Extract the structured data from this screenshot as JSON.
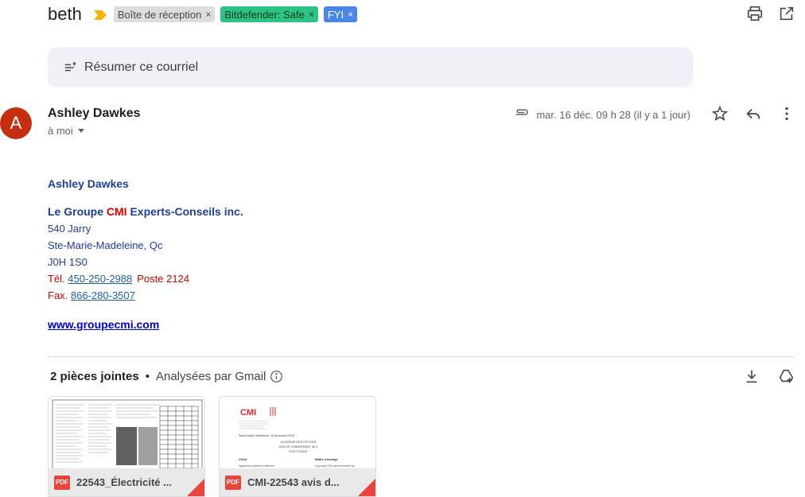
{
  "subject": "beth",
  "labels": [
    {
      "text": "Boîte de réception",
      "color": "#dddddd"
    },
    {
      "text": "Bitdefender: Safe",
      "color": "#2cc383"
    },
    {
      "text": "FYI",
      "color": "#4a86e8"
    }
  ],
  "icons": {
    "print": "print-icon",
    "popout": "open-in-new-window-icon",
    "summarize": "summarize-sparkle-icon",
    "attachment": "paperclip-icon",
    "star": "star-icon",
    "reply": "reply-icon",
    "more": "more-vertical-icon",
    "info": "info-icon",
    "download_all": "download-icon",
    "drive": "add-to-drive-icon"
  },
  "summarize": {
    "label": "Résumer ce courriel"
  },
  "message": {
    "avatar_letter": "A",
    "avatar_color": "#c4300f",
    "sender": "Ashley Dawkes",
    "recipient": "à moi",
    "date": "mar. 16 déc. 09 h 28 (il y a 1 jour)"
  },
  "signature": {
    "name": "Ashley Dawkes",
    "company_prefix": "Le Groupe ",
    "company_highlight": "CMI",
    "company_suffix": " Experts-Conseils inc.",
    "address_1": "540 Jarry",
    "address_2": "Ste-Marie-Madeleine, Qc",
    "address_3": "J0H 1S0",
    "tel_label": "Tél. ",
    "tel_number": "450-250-2988",
    "tel_ext": "Poste 2124",
    "fax_label": "Fax. ",
    "fax_number": "866-280-3507",
    "website": "www.groupecmi.com"
  },
  "attachments": {
    "count_label": "2 pièces jointes",
    "separator": "•",
    "scanned_label": "Analysées par Gmail",
    "files": [
      {
        "name": "22543_Électricité ...",
        "type": "PDF"
      },
      {
        "name": "CMI-22543 avis d...",
        "type": "PDF"
      }
    ]
  },
  "thumb2": {
    "logo": "CMI",
    "date_line": "Sainte-Marie-Madeleine, 15 décembre 2025",
    "title_1": "ACADÉMIE BETH ESTHER",
    "title_2": "AVIS DE CHANGEMENT #E-1",
    "title_3": "ÉLECTRIQUE",
    "col_left": "Client",
    "col_right": "Maître d'ouvrage",
    "row_left": "Ingénieurs-conseils en bâtiment",
    "row_right": "Le groupe CMI experts-conseils inc."
  }
}
